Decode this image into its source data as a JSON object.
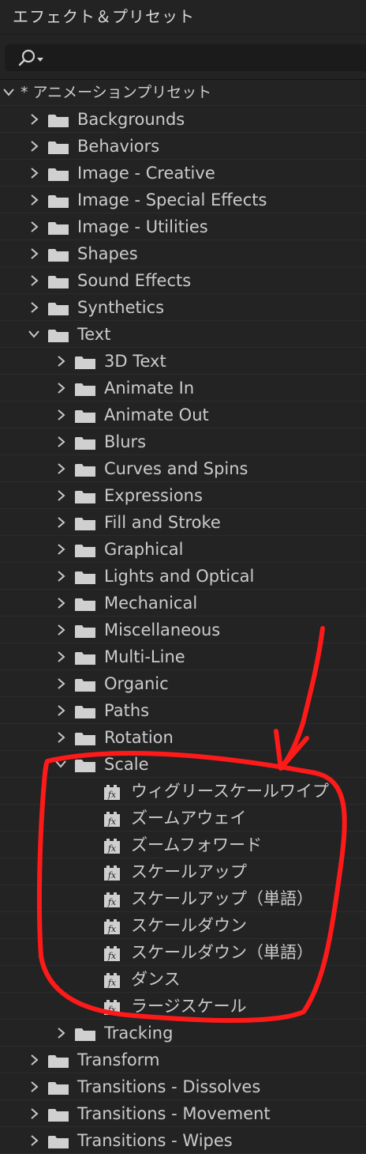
{
  "panel": {
    "title": "エフェクト＆プリセット"
  },
  "search": {
    "placeholder": "",
    "value": ""
  },
  "tree": [
    {
      "label": "* アニメーションプリセット",
      "level": 0,
      "type": "folder",
      "expanded": true
    },
    {
      "label": "Backgrounds",
      "level": 1,
      "type": "folder",
      "expanded": false
    },
    {
      "label": "Behaviors",
      "level": 1,
      "type": "folder",
      "expanded": false
    },
    {
      "label": "Image - Creative",
      "level": 1,
      "type": "folder",
      "expanded": false
    },
    {
      "label": "Image - Special Effects",
      "level": 1,
      "type": "folder",
      "expanded": false
    },
    {
      "label": "Image - Utilities",
      "level": 1,
      "type": "folder",
      "expanded": false
    },
    {
      "label": "Shapes",
      "level": 1,
      "type": "folder",
      "expanded": false
    },
    {
      "label": "Sound Effects",
      "level": 1,
      "type": "folder",
      "expanded": false
    },
    {
      "label": "Synthetics",
      "level": 1,
      "type": "folder",
      "expanded": false
    },
    {
      "label": "Text",
      "level": 1,
      "type": "folder",
      "expanded": true
    },
    {
      "label": "3D Text",
      "level": 2,
      "type": "folder",
      "expanded": false
    },
    {
      "label": "Animate In",
      "level": 2,
      "type": "folder",
      "expanded": false
    },
    {
      "label": "Animate Out",
      "level": 2,
      "type": "folder",
      "expanded": false
    },
    {
      "label": "Blurs",
      "level": 2,
      "type": "folder",
      "expanded": false
    },
    {
      "label": "Curves and Spins",
      "level": 2,
      "type": "folder",
      "expanded": false
    },
    {
      "label": "Expressions",
      "level": 2,
      "type": "folder",
      "expanded": false
    },
    {
      "label": "Fill and Stroke",
      "level": 2,
      "type": "folder",
      "expanded": false
    },
    {
      "label": "Graphical",
      "level": 2,
      "type": "folder",
      "expanded": false
    },
    {
      "label": "Lights and Optical",
      "level": 2,
      "type": "folder",
      "expanded": false
    },
    {
      "label": "Mechanical",
      "level": 2,
      "type": "folder",
      "expanded": false
    },
    {
      "label": "Miscellaneous",
      "level": 2,
      "type": "folder",
      "expanded": false
    },
    {
      "label": "Multi-Line",
      "level": 2,
      "type": "folder",
      "expanded": false
    },
    {
      "label": "Organic",
      "level": 2,
      "type": "folder",
      "expanded": false
    },
    {
      "label": "Paths",
      "level": 2,
      "type": "folder",
      "expanded": false
    },
    {
      "label": "Rotation",
      "level": 2,
      "type": "folder",
      "expanded": false
    },
    {
      "label": "Scale",
      "level": 2,
      "type": "folder",
      "expanded": true
    },
    {
      "label": "ウィグリースケールワイプ",
      "level": 3,
      "type": "preset"
    },
    {
      "label": "ズームアウェイ",
      "level": 3,
      "type": "preset"
    },
    {
      "label": "ズームフォワード",
      "level": 3,
      "type": "preset"
    },
    {
      "label": "スケールアップ",
      "level": 3,
      "type": "preset"
    },
    {
      "label": "スケールアップ（単語）",
      "level": 3,
      "type": "preset"
    },
    {
      "label": "スケールダウン",
      "level": 3,
      "type": "preset"
    },
    {
      "label": "スケールダウン（単語）",
      "level": 3,
      "type": "preset"
    },
    {
      "label": "ダンス",
      "level": 3,
      "type": "preset"
    },
    {
      "label": "ラージスケール",
      "level": 3,
      "type": "preset"
    },
    {
      "label": "Tracking",
      "level": 2,
      "type": "folder",
      "expanded": false
    },
    {
      "label": "Transform",
      "level": 1,
      "type": "folder",
      "expanded": false
    },
    {
      "label": "Transitions - Dissolves",
      "level": 1,
      "type": "folder",
      "expanded": false
    },
    {
      "label": "Transitions - Movement",
      "level": 1,
      "type": "folder",
      "expanded": false
    },
    {
      "label": "Transitions - Wipes",
      "level": 1,
      "type": "folder",
      "expanded": false
    }
  ],
  "icons": {
    "search": "magnifier-icon",
    "folder": "folder-icon",
    "preset": "fx-preset-icon",
    "collapsed": "chevron-right-icon",
    "expanded": "chevron-down-icon"
  },
  "colors": {
    "background": "#232323",
    "text": "#cbcbcb",
    "folder": "#d0d0d0",
    "annotation": "#ff1a1a"
  }
}
